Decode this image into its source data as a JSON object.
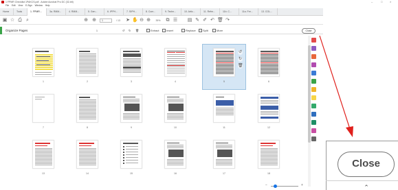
{
  "window": {
    "title": "1 FPMR Checklist 1PAKCS.pdf - Adobe Acrobat Pro DC (32-bit)"
  },
  "menu": [
    "File",
    "Edit",
    "View",
    "E-Sign",
    "Window",
    "Help"
  ],
  "tabs": [
    {
      "label": "Home"
    },
    {
      "label": "Tools"
    },
    {
      "label": "1. FPMR...",
      "active": true
    },
    {
      "label": "3a. RMM..."
    },
    {
      "label": "4. RMM..."
    },
    {
      "label": "5. Gen..."
    },
    {
      "label": "6. IPPH..."
    },
    {
      "label": "7. SIPH..."
    },
    {
      "label": "8. Com..."
    },
    {
      "label": "9. Techn..."
    },
    {
      "label": "10. Artic..."
    },
    {
      "label": "11. Refm..."
    },
    {
      "label": "11b. C..."
    },
    {
      "label": "11a. Fre..."
    },
    {
      "label": "13. COL..."
    }
  ],
  "toolbar": {
    "page_current": "1",
    "page_total": "/ 13",
    "zoom": "39%"
  },
  "organize": {
    "title": "Organize Pages",
    "page_select": "1",
    "buttons": [
      "Extract",
      "Insert",
      "Replace",
      "Split",
      "More"
    ],
    "close_label": "Close"
  },
  "pages": [
    {
      "n": "1",
      "style": "yellow"
    },
    {
      "n": "2",
      "style": "text"
    },
    {
      "n": "3",
      "style": "form"
    },
    {
      "n": "4",
      "style": "table"
    },
    {
      "n": "5",
      "style": "dense"
    },
    {
      "n": "6",
      "style": "dense"
    },
    {
      "n": "7",
      "style": "blank"
    },
    {
      "n": "8",
      "style": "text"
    },
    {
      "n": "9",
      "style": "figure"
    },
    {
      "n": "10",
      "style": "figure"
    },
    {
      "n": "11",
      "style": "light"
    },
    {
      "n": "12",
      "style": "blue"
    },
    {
      "n": "13",
      "style": "red"
    },
    {
      "n": "14",
      "style": "red"
    },
    {
      "n": "15",
      "style": "list"
    },
    {
      "n": "16",
      "style": "figure"
    },
    {
      "n": "17",
      "style": "figure"
    },
    {
      "n": "18",
      "style": "red"
    }
  ],
  "selected_page": "5",
  "zoom_inset": {
    "close_label": "Close"
  },
  "colors": {
    "annotation_arrow": "#e0201c",
    "accent": "#1473e6",
    "organize_green": "#3aa348"
  },
  "icons": [
    "save-icon",
    "star-icon",
    "print-icon",
    "search-icon",
    "rotate-left-icon",
    "rotate-right-icon",
    "delete-icon"
  ]
}
